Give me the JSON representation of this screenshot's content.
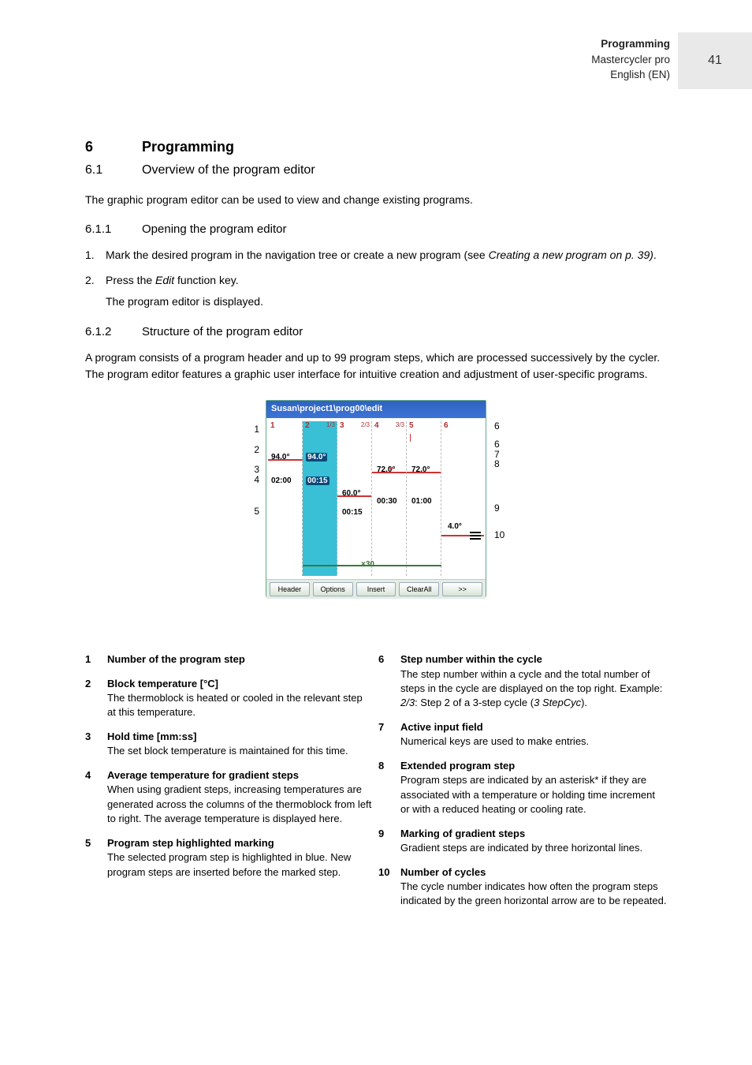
{
  "header": {
    "section": "Programming",
    "product": "Mastercycler pro",
    "lang": "English (EN)",
    "page": "41"
  },
  "h6": {
    "num": "6",
    "title": "Programming"
  },
  "h61": {
    "num": "6.1",
    "title": "Overview of the program editor"
  },
  "p_intro": "The graphic program editor can be used to view and change existing programs.",
  "h611": {
    "num": "6.1.1",
    "title": "Opening the program editor"
  },
  "steps611": {
    "s1": {
      "n": "1.",
      "pre": "Mark the desired program in the navigation tree or create a new program (see ",
      "link": "Creating a new program on p. 39)",
      "post": "."
    },
    "s2": {
      "n": "2.",
      "pre": "Press the ",
      "link": "Edit",
      "post": " function key.",
      "result": "The program editor is displayed."
    }
  },
  "h612": {
    "num": "6.1.2",
    "title": "Structure of the program editor"
  },
  "p_struct": "A program consists of a program header and up to 99 program steps, which are processed successively by the cycler. The program editor features a graphic user interface for intuitive creation and adjustment of user-specific programs.",
  "editor": {
    "title": "Susan\\project1\\prog00\\edit",
    "stepnums": {
      "s1": "1",
      "s2": "2",
      "s3": "3",
      "s4": "4",
      "s5": "5",
      "s6": "6"
    },
    "cyc": {
      "s2": "1/3",
      "s3": "2/3",
      "s4": "3/3"
    },
    "temps": {
      "s1": "94.0°",
      "s2": "94.0°",
      "s3": "60.0°",
      "s4": "72.0°",
      "s5": "72.0°",
      "s6": "4.0°"
    },
    "times": {
      "s1": "02:00",
      "s2": "00:15",
      "s3": "00:15",
      "s4": "00:30",
      "s5": "01:00"
    },
    "cycx": "×30",
    "buttons": {
      "b1": "Header",
      "b2": "Options",
      "b3": "Insert",
      "b4": "ClearAll",
      "b5": ">>"
    }
  },
  "callouts": {
    "c1": "1",
    "c2": "2",
    "c3": "3",
    "c4": "4",
    "c5": "5",
    "c6": "6",
    "c7": "7",
    "c8": "8",
    "c9": "9",
    "c10": "10"
  },
  "legend": {
    "l1": {
      "n": "1",
      "t": "Number of the program step"
    },
    "l2": {
      "n": "2",
      "t": "Block temperature [°C]",
      "d": "The thermoblock is heated or cooled in the relevant step at this temperature."
    },
    "l3": {
      "n": "3",
      "t": "Hold time [mm:ss]",
      "d": "The set block temperature is maintained for this time."
    },
    "l4": {
      "n": "4",
      "t": "Average temperature for gradient steps",
      "d": "When using gradient steps, increasing temperatures are generated across the columns of the thermoblock from left to right. The average temperature is displayed here."
    },
    "l5": {
      "n": "5",
      "t": "Program step highlighted marking",
      "d": "The selected program step is highlighted in blue. New program steps are inserted before the marked step."
    },
    "l6": {
      "n": "6",
      "t": "Step number within the cycle",
      "d_pre": "The step number within a cycle and the total number of steps in the cycle are displayed on the top right. Example: ",
      "d_ex1": "2/3",
      "d_mid": ": Step 2 of a 3-step cycle (",
      "d_ex2": "3 StepCyc",
      "d_post": ")."
    },
    "l7": {
      "n": "7",
      "t": "Active input field",
      "d": "Numerical keys are used to make entries."
    },
    "l8": {
      "n": "8",
      "t": "Extended program step",
      "d": "Program steps are indicated by an asterisk* if they are associated with a temperature or holding time increment or with a reduced heating or cooling rate."
    },
    "l9": {
      "n": "9",
      "t": "Marking of gradient steps",
      "d": "Gradient steps are indicated by three horizontal lines."
    },
    "l10": {
      "n": "10",
      "t": "Number of cycles",
      "d": "The cycle number indicates how often the program steps indicated by the green horizontal arrow are to be repeated."
    }
  }
}
